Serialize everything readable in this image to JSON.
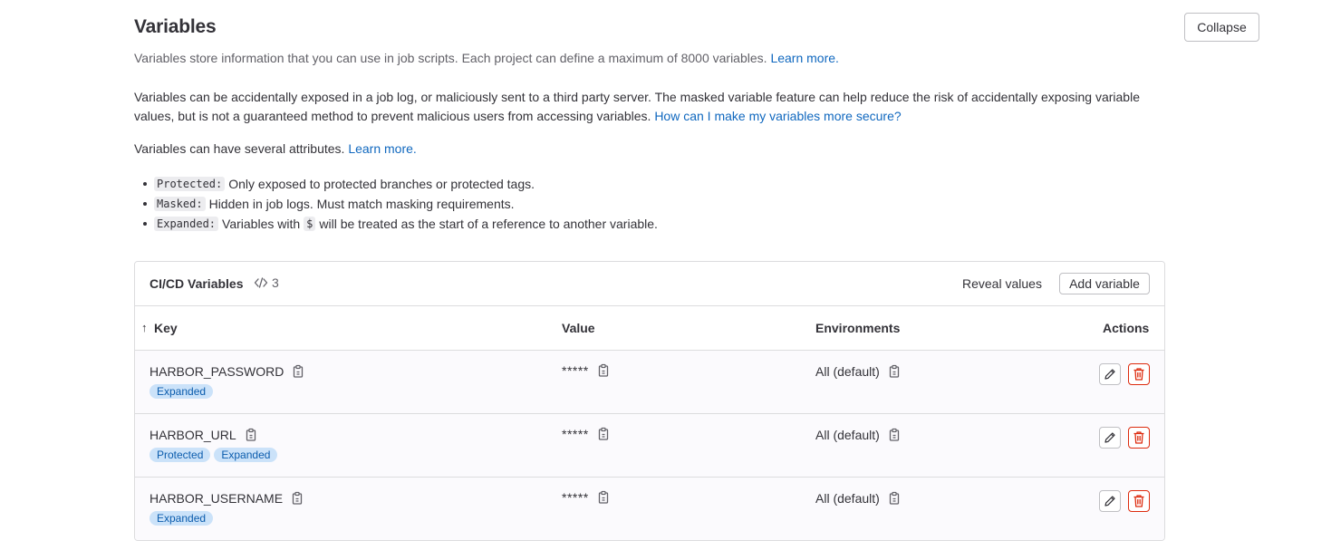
{
  "section": {
    "title": "Variables",
    "collapse_label": "Collapse",
    "description": "Variables store information that you can use in job scripts. Each project can define a maximum of 8000 variables.",
    "description_link": "Learn more.",
    "warning": "Variables can be accidentally exposed in a job log, or maliciously sent to a third party server. The masked variable feature can help reduce the risk of accidentally exposing variable values, but is not a guaranteed method to prevent malicious users from accessing variables.",
    "warning_link": "How can I make my variables more secure?",
    "attributes_intro": "Variables can have several attributes.",
    "attributes_link": "Learn more.",
    "attributes": [
      {
        "code": "Protected:",
        "text": "Only exposed to protected branches or protected tags."
      },
      {
        "code": "Masked:",
        "text": "Hidden in job logs. Must match masking requirements."
      },
      {
        "code": "Expanded:",
        "text_before": "Variables with",
        "code2": "$",
        "text": "will be treated as the start of a reference to another variable."
      }
    ]
  },
  "card": {
    "title": "CI/CD Variables",
    "count": "3",
    "reveal_label": "Reveal values",
    "add_label": "Add variable",
    "columns": {
      "sort_arrow": "↑",
      "key": "Key",
      "value": "Value",
      "environments": "Environments",
      "actions": "Actions"
    },
    "rows": [
      {
        "key": "HARBOR_PASSWORD",
        "value": "*****",
        "environment": "All (default)",
        "badges": [
          "Expanded"
        ]
      },
      {
        "key": "HARBOR_URL",
        "value": "*****",
        "environment": "All (default)",
        "badges": [
          "Protected",
          "Expanded"
        ]
      },
      {
        "key": "HARBOR_USERNAME",
        "value": "*****",
        "environment": "All (default)",
        "badges": [
          "Expanded"
        ]
      }
    ]
  },
  "colors": {
    "link": "#1068bf",
    "badge_bg": "#cbe2f9",
    "badge_text": "#0b5cad",
    "danger": "#dd2b0e"
  }
}
